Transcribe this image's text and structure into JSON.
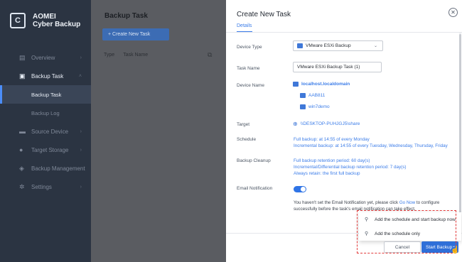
{
  "app": {
    "name_line1": "AOMEI",
    "name_line2": "Cyber Backup",
    "logo_letter": "C"
  },
  "sidebar": {
    "items": [
      {
        "label": "Overview",
        "icon": "overview-icon"
      },
      {
        "label": "Backup Task",
        "icon": "backup-task-icon"
      },
      {
        "label": "Source Device",
        "icon": "monitor-icon"
      },
      {
        "label": "Target Storage",
        "icon": "location-pin-icon"
      },
      {
        "label": "Backup Management",
        "icon": "stack-icon"
      },
      {
        "label": "Settings",
        "icon": "gear-icon"
      }
    ],
    "subitems": [
      {
        "label": "Backup Task"
      },
      {
        "label": "Backup Log"
      }
    ]
  },
  "middle": {
    "title": "Backup Task",
    "create_button": "+ Create New Task",
    "col_type": "Type",
    "col_task_name": "Task Name"
  },
  "dialog": {
    "title": "Create New Task",
    "tab": "Details",
    "labels": {
      "device_type": "Device Type",
      "task_name": "Task Name",
      "device_name": "Device Name",
      "target": "Target",
      "schedule": "Schedule",
      "backup_cleanup": "Backup Cleanup",
      "email_notification": "Email Notification"
    },
    "device_type_value": "VMware ESXi Backup",
    "task_name_value": "VMware ESXi Backup Task (1)",
    "device_host": "localhost.localdomain",
    "devices": [
      "AAB811",
      "win7demo"
    ],
    "target_value": "\\\\DESKTOP-PUHJGJ5\\share",
    "schedule_lines": [
      "Full backup: at 14:55 of every Monday",
      "Incremental backup: at 14:55 of every Tuesday, Wednesday, Thursday, Friday"
    ],
    "cleanup_lines": [
      "Full backup retention period: 60 day(s)",
      "Incremental/Differential backup retention period: 7 day(s)",
      "Always retain: the first full backup"
    ],
    "email_enabled": true,
    "note_before": "You haven't set the Email Notification yet, please click ",
    "note_link": "Go Now",
    "note_after": " to configure successfully before the task's email notification can take effect.",
    "dropdown_items": [
      "Add the schedule and start backup now",
      "Add the schedule only"
    ],
    "cancel_label": "Cancel",
    "start_label": "Start Backup"
  },
  "colors": {
    "accent": "#2f6fd8",
    "sidebar": "#2b3442",
    "highlight": "#e23a3a"
  }
}
